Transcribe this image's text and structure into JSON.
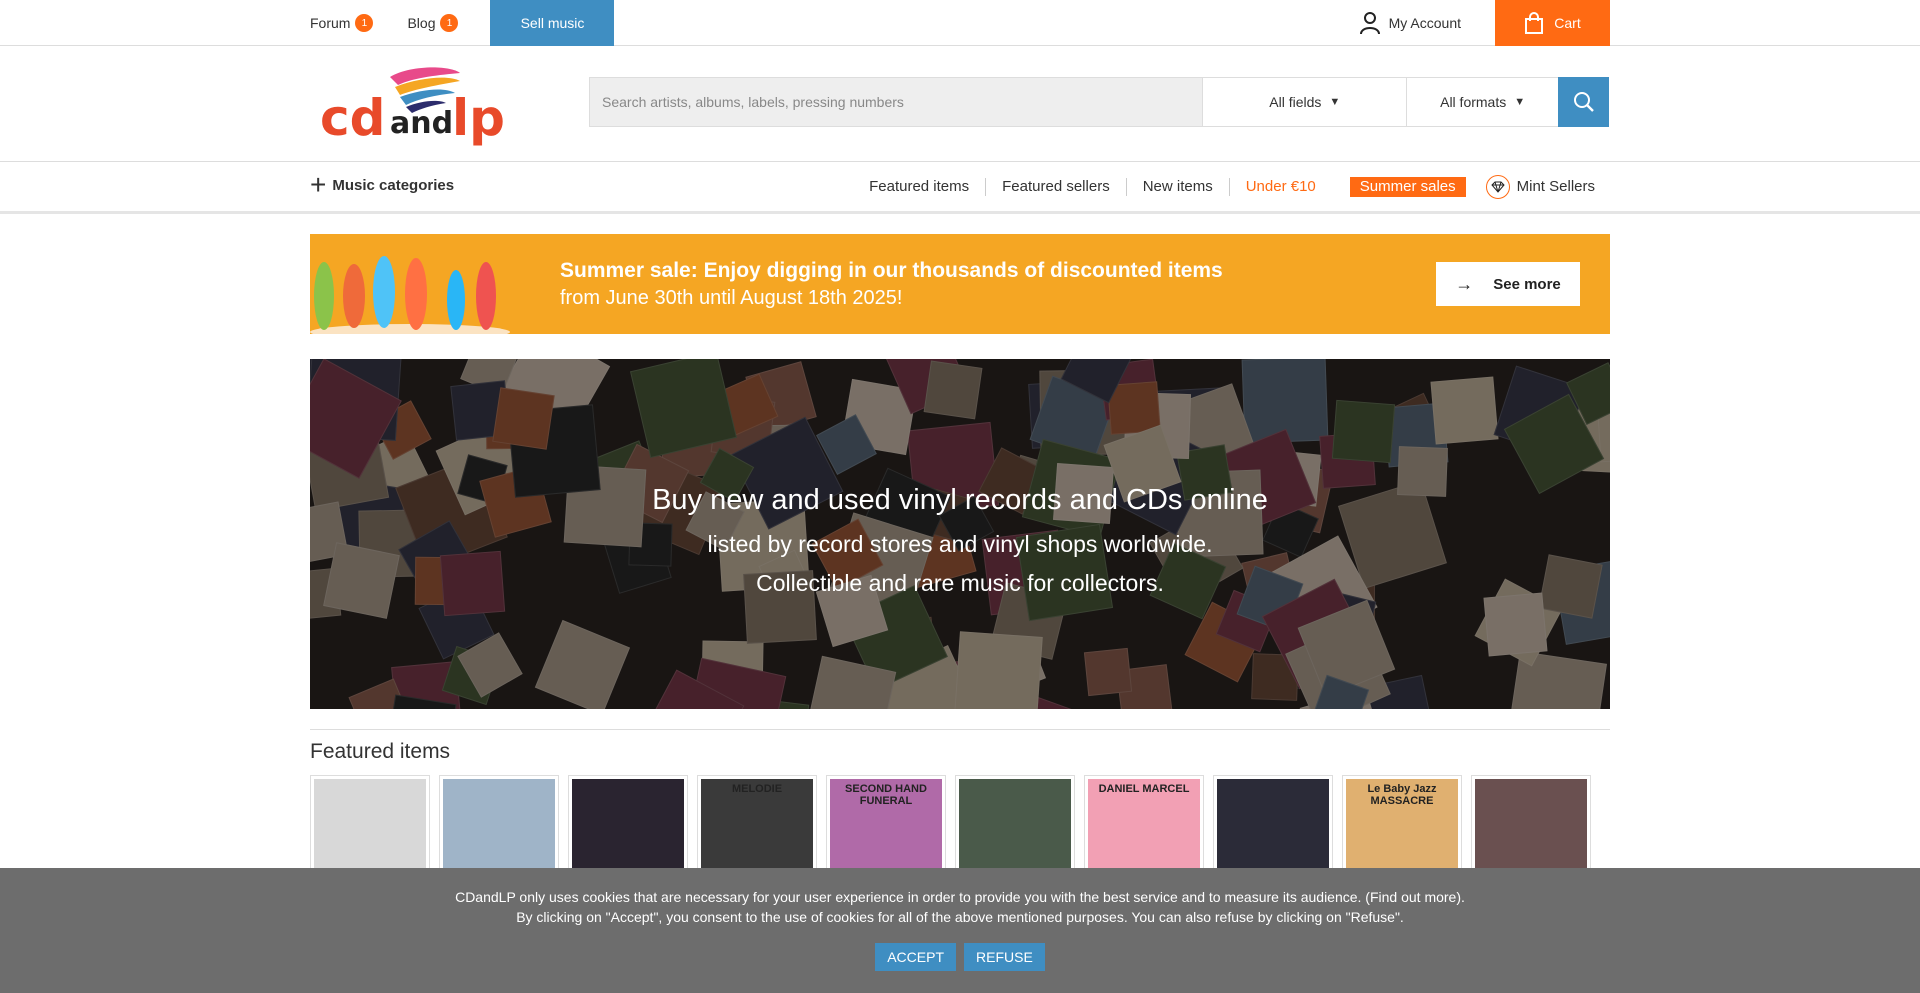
{
  "topbar": {
    "forum_label": "Forum",
    "forum_badge": "1",
    "blog_label": "Blog",
    "blog_badge": "1",
    "sell_label": "Sell music",
    "account_label": "My Account",
    "cart_label": "Cart"
  },
  "brand": {
    "logo_text": "cdandlp",
    "accent": "#ff6a13",
    "blue": "#3f8ec2"
  },
  "search": {
    "placeholder": "Search artists, albums, labels, pressing numbers",
    "fields_value": "All fields",
    "formats_value": "All formats"
  },
  "nav": {
    "categories_label": "Music categories",
    "links": [
      "Featured items",
      "Featured sellers",
      "New items",
      "Under €10"
    ],
    "summer_label": "Summer sales",
    "mint_label": "Mint Sellers"
  },
  "sale_banner": {
    "title": "Summer sale: Enjoy digging in our thousands of discounted items",
    "subtitle": "from June 30th until August 18th 2025!",
    "button_label": "See more"
  },
  "hero": {
    "title": "Buy new and used vinyl records and CDs online",
    "subtitle": "listed by record stores and vinyl shops worldwide.",
    "subtitle2": "Collectible and rare music for collectors."
  },
  "featured": {
    "title": "Featured items",
    "items": [
      {
        "label": "",
        "bg": "#d8d8d8"
      },
      {
        "label": "",
        "bg": "#9fb4c8"
      },
      {
        "label": "",
        "bg": "#2a2430"
      },
      {
        "label": "MELODIE",
        "bg": "#3a3a3a"
      },
      {
        "label": "SECOND HAND FUNERAL",
        "bg": "#b06aa8"
      },
      {
        "label": "",
        "bg": "#4a5a4a"
      },
      {
        "label": "DANIEL MARCEL",
        "bg": "#f2a0b4"
      },
      {
        "label": "",
        "bg": "#2b2b38"
      },
      {
        "label": "Le Baby Jazz MASSACRE",
        "bg": "#e0b070"
      },
      {
        "label": "",
        "bg": "#6a5050"
      }
    ]
  },
  "cookie": {
    "line1": "CDandLP only uses cookies that are necessary for your user experience in order to provide you with the best service and to measure its audience. (Find out more).",
    "line2": "By clicking on \"Accept\", you consent to the use of cookies for all of the above mentioned purposes. You can also refuse by clicking on \"Refuse\".",
    "accept_label": "ACCEPT",
    "refuse_label": "REFUSE"
  }
}
